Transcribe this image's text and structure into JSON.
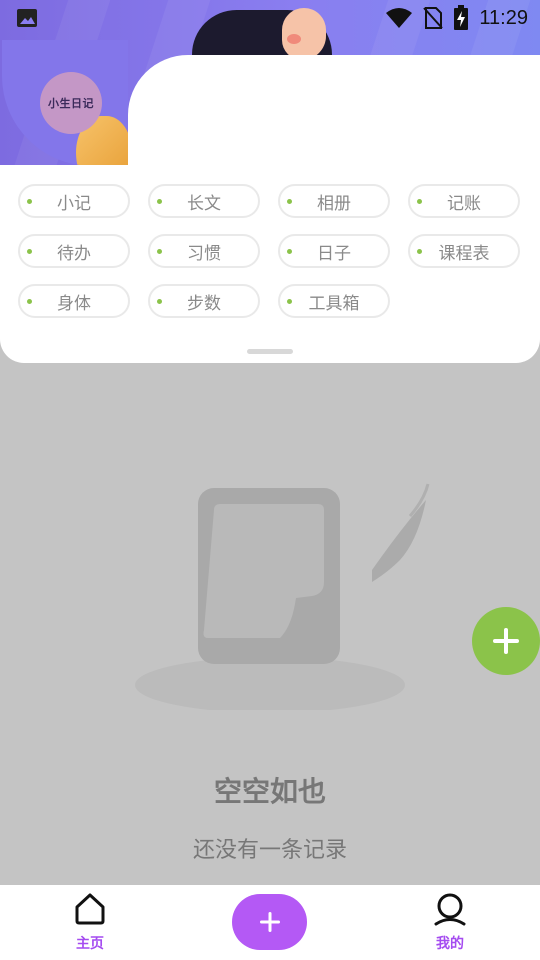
{
  "status_bar": {
    "time": "11:29",
    "icons": [
      "image-icon",
      "wifi-icon",
      "no-sim-icon",
      "battery-charging-icon"
    ]
  },
  "header": {
    "avatar_text": "小生日记"
  },
  "categories": {
    "items": [
      {
        "label": "小记"
      },
      {
        "label": "长文"
      },
      {
        "label": "相册"
      },
      {
        "label": "记账"
      },
      {
        "label": "待办"
      },
      {
        "label": "习惯"
      },
      {
        "label": "日子"
      },
      {
        "label": "课程表"
      },
      {
        "label": "身体"
      },
      {
        "label": "步数"
      },
      {
        "label": "工具箱"
      }
    ],
    "dot_color": "#8bc34a"
  },
  "empty_state": {
    "title": "空空如也",
    "subtitle": "还没有一条记录"
  },
  "fab": {
    "icon": "plus-icon",
    "color": "#8bc34a"
  },
  "bottom_nav": {
    "home_label": "主页",
    "mine_label": "我的",
    "add_icon": "plus-icon",
    "accent": "#a54cf0"
  }
}
